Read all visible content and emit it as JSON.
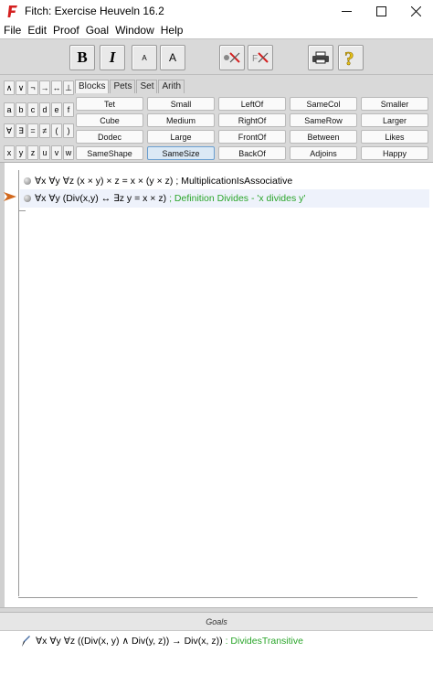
{
  "window": {
    "title": "Fitch: Exercise Heuveln 16.2",
    "minimize": "—",
    "maximize": "☐",
    "close": "✕"
  },
  "menu": [
    "File",
    "Edit",
    "Proof",
    "Goal",
    "Window",
    "Help"
  ],
  "toolbar": {
    "bold": "B",
    "italic": "I",
    "font_small": "A",
    "font_large": "A"
  },
  "symbols": [
    [
      "∧",
      "∨",
      "¬",
      "→",
      "↔",
      "⊥"
    ],
    [
      "a",
      "b",
      "c",
      "d",
      "e",
      "f"
    ],
    [
      "∀",
      "∃",
      "=",
      "≠",
      "(",
      ")"
    ],
    [
      "x",
      "y",
      "z",
      "u",
      "v",
      "w"
    ]
  ],
  "palette_tabs": [
    "Blocks",
    "Pets",
    "Set",
    "Arith"
  ],
  "predicates": [
    [
      "Tet",
      "Small",
      "LeftOf",
      "SameCol",
      "Smaller"
    ],
    [
      "Cube",
      "Medium",
      "RightOf",
      "SameRow",
      "Larger"
    ],
    [
      "Dodec",
      "Large",
      "FrontOf",
      "Between",
      "Likes"
    ],
    [
      "SameShape",
      "SameSize",
      "BackOf",
      "Adjoins",
      "Happy"
    ]
  ],
  "selected_predicate": "SameSize",
  "proof": {
    "steps": [
      {
        "sentence": "∀x ∀y ∀z (x × y) × z = x × (y × z)",
        "rule": "; MultiplicationIsAssociative",
        "rule_color": "black"
      },
      {
        "sentence": "∀x ∀y (Div(x,y) ↔ ∃z y = x × z)",
        "rule": "; Definition Divides - 'x divides y'",
        "rule_color": "green"
      }
    ]
  },
  "goals": {
    "header": "Goals",
    "items": [
      {
        "sentence": "∀x ∀y ∀z ((Div(x, y) ∧ Div(y, z)) → Div(x, z))",
        "rule": ": DividesTransitive"
      }
    ]
  },
  "colors": {
    "accent_green": "#2aa52a",
    "app_icon_red": "#d42020",
    "pointer_orange": "#d2691e",
    "toolbar_gray": "#d9d9d9",
    "selected_blue": "#dbe9f5"
  }
}
